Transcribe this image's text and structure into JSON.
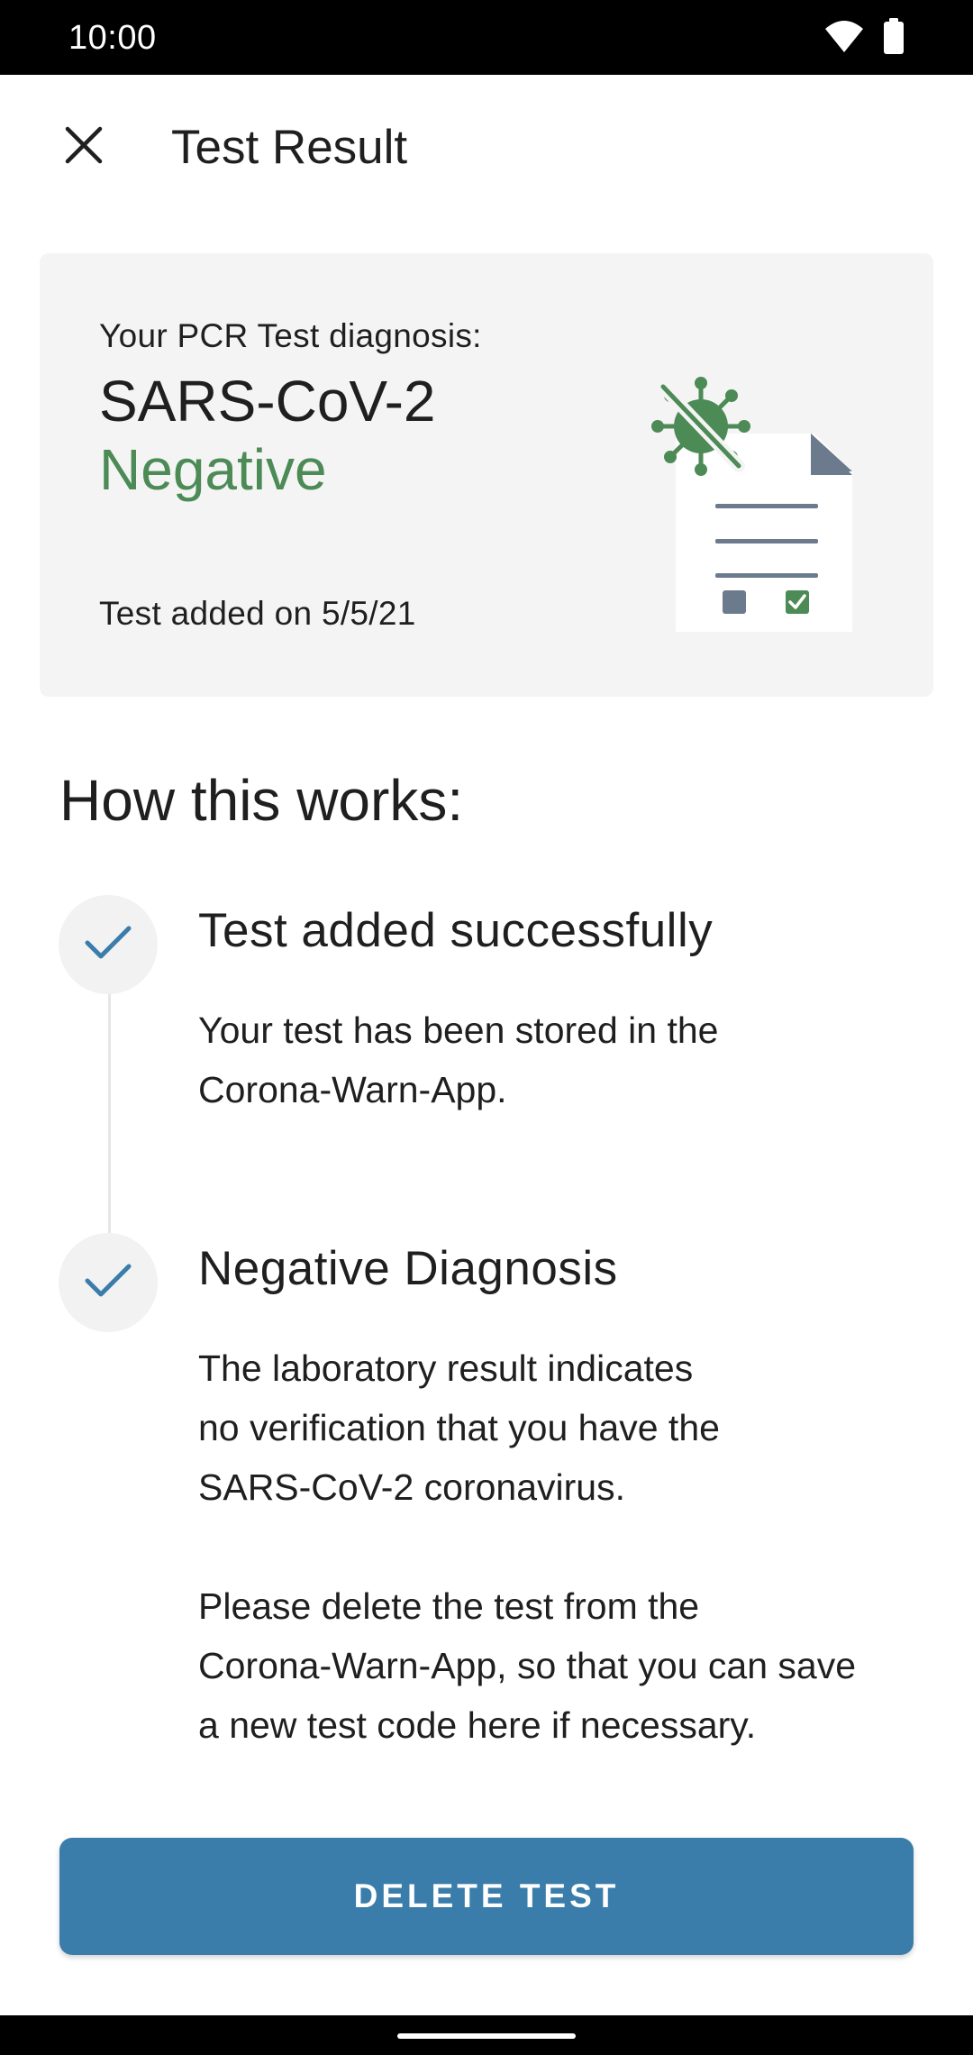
{
  "status_bar": {
    "time": "10:00",
    "icons": [
      "wifi-icon",
      "battery-icon"
    ]
  },
  "appbar": {
    "close_icon": "close-icon",
    "title": "Test Result"
  },
  "result_card": {
    "label": "Your PCR Test diagnosis:",
    "virus": "SARS-CoV-2",
    "result": "Negative",
    "date_text": "Test added on 5/5/21",
    "illustration": "document-negative-virus-illustration"
  },
  "how_it_works": {
    "heading": "How this works:",
    "steps": [
      {
        "icon": "check-icon",
        "title": "Test added successfully",
        "body": [
          "Your test has been stored in the",
          "Corona-Warn-App."
        ]
      },
      {
        "icon": "check-icon",
        "title": "Negative Diagnosis",
        "body_paragraphs": [
          [
            "The laboratory result indicates",
            "no verification that you have the",
            "SARS-CoV-2 coronavirus."
          ],
          [
            "Please delete the test from the",
            "Corona-Warn-App, so that you can save",
            "a new test code here if necessary."
          ]
        ]
      }
    ]
  },
  "actions": {
    "delete_label": "DELETE TEST"
  },
  "colors": {
    "primary": "#3a7dab",
    "negative_green": "#4c8a56",
    "card_background": "#f4f4f4"
  }
}
